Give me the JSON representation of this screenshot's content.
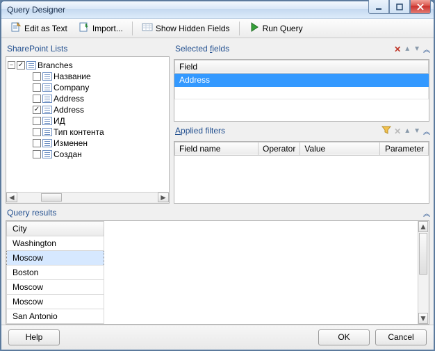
{
  "window": {
    "title": "Query Designer"
  },
  "toolbar": {
    "edit_as_text": "Edit as Text",
    "import": "Import...",
    "show_hidden": "Show Hidden Fields",
    "run_query": "Run Query"
  },
  "sharepoint": {
    "label": "SharePoint Lists",
    "root": "Branches",
    "items": [
      {
        "label": "Название",
        "checked": false
      },
      {
        "label": "Company",
        "checked": false
      },
      {
        "label": "Address",
        "checked": false
      },
      {
        "label": "Address",
        "checked": true
      },
      {
        "label": "ИД",
        "checked": false
      },
      {
        "label": "Тип контента",
        "checked": false
      },
      {
        "label": "Изменен",
        "checked": false
      },
      {
        "label": "Создан",
        "checked": false
      }
    ]
  },
  "selected_fields": {
    "label_pre": "Selected ",
    "label_accel": "f",
    "label_post": "ields",
    "header": "Field",
    "rows": [
      "Address"
    ]
  },
  "applied_filters": {
    "label_accel": "A",
    "label_post": "pplied filters",
    "columns": {
      "field": "Field name",
      "operator": "Operator",
      "value": "Value",
      "parameter": "Parameter"
    }
  },
  "query_results": {
    "label": "Query results",
    "header": "City",
    "rows": [
      "Washington",
      "Moscow",
      "Boston",
      "Moscow",
      "Moscow",
      "San Antonio"
    ],
    "selected_index": 1
  },
  "footer": {
    "help": "Help",
    "ok": "OK",
    "cancel": "Cancel"
  }
}
